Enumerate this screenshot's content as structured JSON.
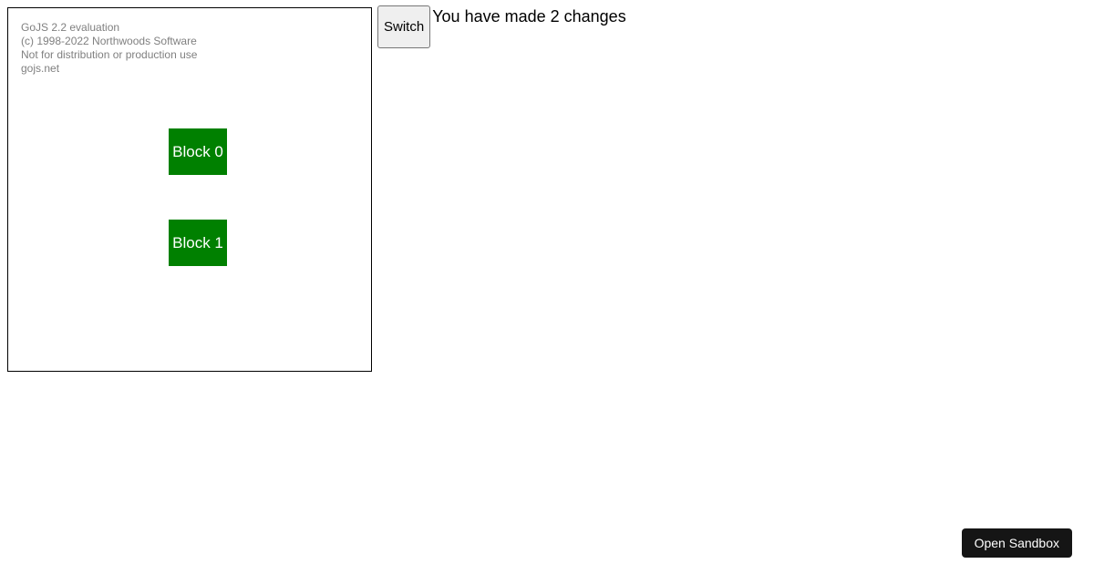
{
  "watermark": {
    "line1": "GoJS 2.2 evaluation",
    "line2": "(c) 1998-2022 Northwoods Software",
    "line3": "Not for distribution or production use",
    "line4": "gojs.net"
  },
  "nodes": [
    {
      "label": "Block 0"
    },
    {
      "label": "Block 1"
    }
  ],
  "controls": {
    "switch_label": "Switch"
  },
  "status": {
    "prefix": "You have made ",
    "count": "2",
    "suffix": " changes"
  },
  "sandbox": {
    "label": "Open Sandbox"
  },
  "colors": {
    "node_fill": "#008000",
    "node_text": "#ffffff",
    "watermark": "#808080"
  }
}
